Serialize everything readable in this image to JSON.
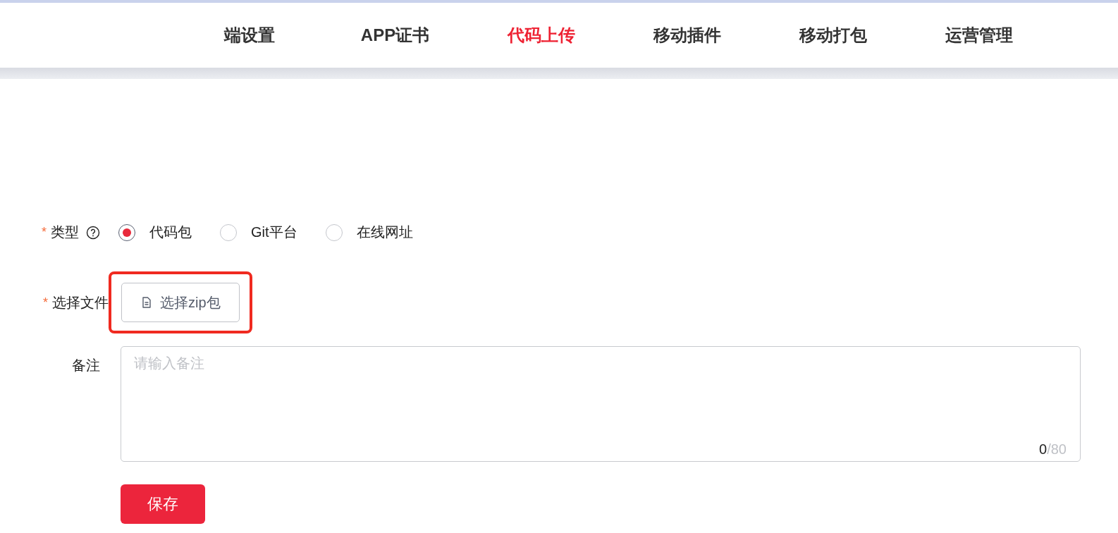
{
  "tabs": [
    {
      "label": "端设置",
      "selected": false
    },
    {
      "label": "APP证书",
      "selected": false
    },
    {
      "label": "代码上传",
      "selected": true
    },
    {
      "label": "移动插件",
      "selected": false
    },
    {
      "label": "移动打包",
      "selected": false
    },
    {
      "label": "运营管理",
      "selected": false
    }
  ],
  "form": {
    "type_field": {
      "label": "类型",
      "required_mark": "*",
      "options": [
        {
          "label": "代码包",
          "selected": true
        },
        {
          "label": "Git平台",
          "selected": false
        },
        {
          "label": "在线网址",
          "selected": false
        }
      ]
    },
    "file_field": {
      "label": "选择文件",
      "required_mark": "*",
      "button": "选择zip包",
      "highlighted": true
    },
    "remark_field": {
      "label": "备注",
      "placeholder": "请输入备注",
      "count": "0",
      "limit": "/80"
    },
    "save_button": "保存"
  }
}
